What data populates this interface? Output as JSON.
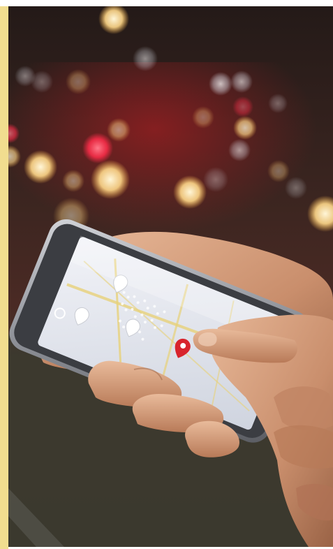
{
  "page": {
    "accent_color": "#f1dd8f",
    "background_color": "#ffffff"
  },
  "photo": {
    "subject": "hand-tapping-smartphone-map",
    "palette": {
      "night_top": "#2c201d",
      "night_mid": "#3a2620",
      "ground": "#3f3b2f",
      "skin_light": "#e2b090",
      "skin_mid": "#c98e6c",
      "skin_shadow": "#9a6346",
      "phone_frame": "#9a9ca2",
      "screen": "#e9ebf2",
      "map_roads": "#e8d27a",
      "pin_color": "#d8242c",
      "bokeh_warm": "#ffd88a",
      "bokeh_red": "#ff2d4a",
      "bokeh_cool": "#e7eef8"
    }
  }
}
